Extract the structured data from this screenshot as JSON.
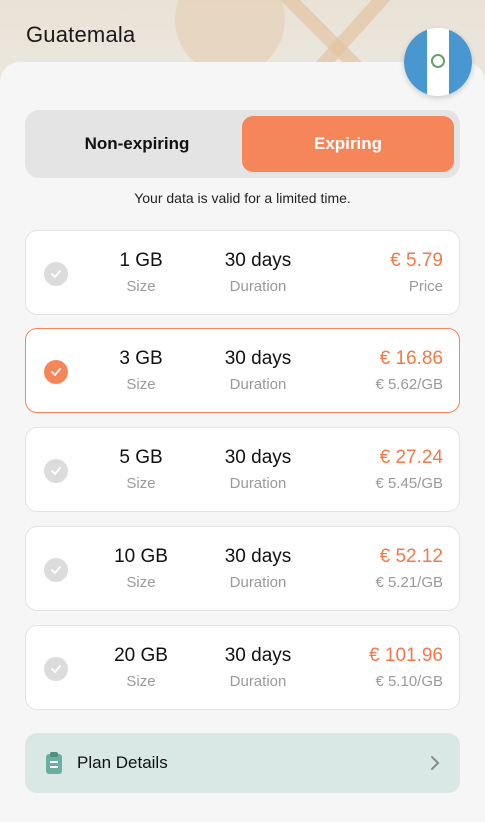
{
  "header": {
    "country": "Guatemala",
    "flag_icon": "guatemala-flag"
  },
  "toggle": {
    "options": [
      "Non-expiring",
      "Expiring"
    ],
    "selected": "Expiring"
  },
  "subtitle": "Your data is valid for a limited time.",
  "plans": [
    {
      "size": "1 GB",
      "size_label": "Size",
      "duration": "30 days",
      "duration_label": "Duration",
      "price": "€ 5.79",
      "price_sub": "Price",
      "selected": false
    },
    {
      "size": "3 GB",
      "size_label": "Size",
      "duration": "30 days",
      "duration_label": "Duration",
      "price": "€ 16.86",
      "price_sub": "€ 5.62/GB",
      "selected": true
    },
    {
      "size": "5 GB",
      "size_label": "Size",
      "duration": "30 days",
      "duration_label": "Duration",
      "price": "€ 27.24",
      "price_sub": "€ 5.45/GB",
      "selected": false
    },
    {
      "size": "10 GB",
      "size_label": "Size",
      "duration": "30 days",
      "duration_label": "Duration",
      "price": "€ 52.12",
      "price_sub": "€ 5.21/GB",
      "selected": false
    },
    {
      "size": "20 GB",
      "size_label": "Size",
      "duration": "30 days",
      "duration_label": "Duration",
      "price": "€ 101.96",
      "price_sub": "€ 5.10/GB",
      "selected": false
    }
  ],
  "details": {
    "label": "Plan Details",
    "icon": "clipboard-icon",
    "chevron": "chevron-right-icon"
  },
  "colors": {
    "accent": "#f5865a",
    "price": "#f07a4a",
    "details_bg": "#d9e8e5",
    "flag_blue": "#4997d0"
  }
}
